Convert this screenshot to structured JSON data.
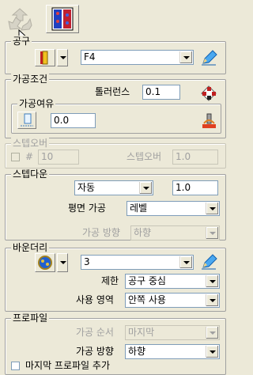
{
  "toolbar": {
    "recycle_icon": "recycle-icon",
    "tool_icon": "strategy-icon"
  },
  "tool_section": {
    "legend": "공구",
    "tool_name": "F4"
  },
  "machining_conditions": {
    "legend": "가공조건",
    "tolerance_label": "톨러런스",
    "tolerance_value": "0.1",
    "allowance_legend": "가공여유",
    "allowance_value": "0.0"
  },
  "stepover": {
    "legend": "스텝오버",
    "hash_label": "#",
    "count_value": "10",
    "stepover_label": "스텝오버",
    "stepover_value": "1.0"
  },
  "stepdown": {
    "legend": "스텝다운",
    "mode_value": "자동",
    "stepdown_value": "1.0",
    "flat_label": "평면 가공",
    "flat_value": "레벨",
    "direction_label": "가공 방향",
    "direction_value": "하향"
  },
  "boundary": {
    "legend": "바운더리",
    "boundary_name": "3",
    "limit_label": "제한",
    "limit_value": "공구 중심",
    "area_label": "사용 영역",
    "area_value": "안쪽 사용"
  },
  "profile": {
    "legend": "프로파일",
    "order_label": "가공 순서",
    "order_value": "마지막",
    "direction_label": "가공 방향",
    "direction_value": "하향",
    "last_profile_label": "마지막 프로파일 추가"
  }
}
